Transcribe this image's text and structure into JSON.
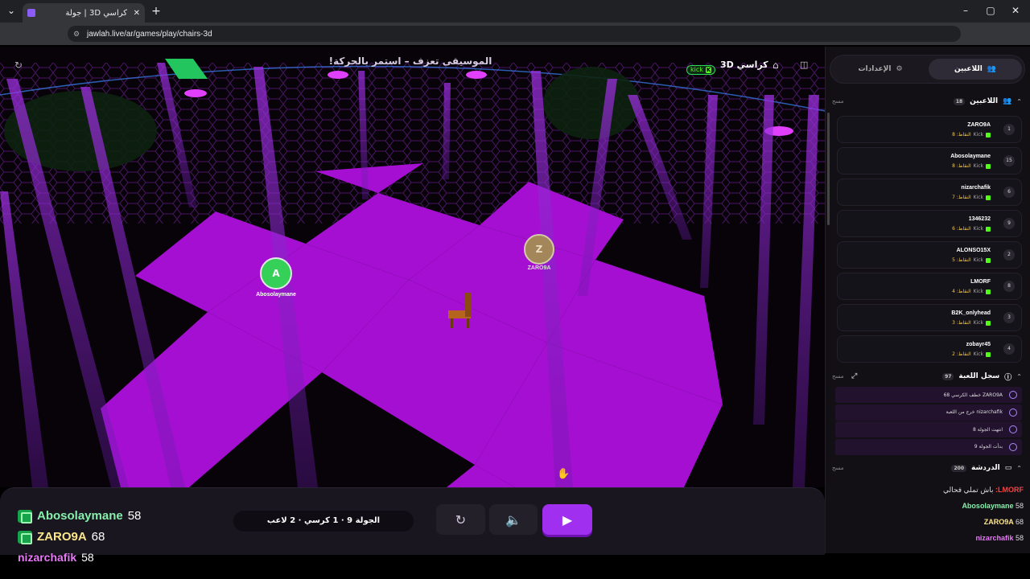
{
  "browser": {
    "tab_title": "كراسي 3D | جولة",
    "url": "jawlah.live/ar/games/play/chairs-3d",
    "new_tab_icon": "plus-icon"
  },
  "game": {
    "music_banner": "الموسيقى تعزف – استمر بالحركة!",
    "title": "كراسي 3D",
    "kick_label": "kick",
    "player_tokens": [
      {
        "initial": "A",
        "name": "Abosolaymane"
      },
      {
        "initial": "Z",
        "name": "ZARO9A"
      }
    ]
  },
  "bottom": {
    "leaderboard": [
      {
        "name": "Abosolaymane",
        "score": "58",
        "color": "#86efac"
      },
      {
        "name": "ZARO9A",
        "score": "68",
        "color": "#fde68a"
      },
      {
        "name": "nizarchafik",
        "score": "58",
        "color": "#e879f9"
      }
    ],
    "round_status": "الجولة 9 · 1 كرسي · 2 لاعب"
  },
  "sidebar": {
    "tabs": {
      "players": "اللاعبين",
      "settings": "الإعدادات"
    },
    "players_section": {
      "title": "اللاعبين",
      "count": "18",
      "clear": "مسح"
    },
    "players": [
      {
        "rank": "1",
        "name": "ZARO9A",
        "points": "النقاط: 8",
        "kick": "Kick"
      },
      {
        "rank": "15",
        "name": "Abosolaymane",
        "points": "النقاط: 8",
        "kick": "Kick"
      },
      {
        "rank": "6",
        "name": "nizarchafik",
        "points": "النقاط: 7",
        "kick": "Kick"
      },
      {
        "rank": "9",
        "name": "1346232",
        "points": "النقاط: 6",
        "kick": "Kick"
      },
      {
        "rank": "2",
        "name": "ALONSO15X",
        "points": "النقاط: 5",
        "kick": "Kick"
      },
      {
        "rank": "8",
        "name": "LMORF",
        "points": "النقاط: 4",
        "kick": "Kick"
      },
      {
        "rank": "3",
        "name": "B2K_onlyhead",
        "points": "النقاط: 3",
        "kick": "Kick"
      },
      {
        "rank": "4",
        "name": "zobayr45",
        "points": "النقاط: 2",
        "kick": "Kick"
      }
    ],
    "log_section": {
      "title": "سجل اللعبة",
      "count": "97",
      "clear": "مسح"
    },
    "log": [
      "ZARO9A خطف الكرسي 68",
      "nizarchafik خرج من اللعبة",
      "انتهت الجولة 8",
      "بدأت الجولة 9"
    ],
    "chat_section": {
      "title": "الدردشة",
      "count": "200",
      "clear": "مسح"
    },
    "chat": [
      {
        "user": "LMORF:",
        "text": "باش تملي فحالي",
        "color": "#ef4444"
      },
      {
        "user": "Abosolaymane",
        "text": "58",
        "color": "#86efac"
      },
      {
        "user": "ZARO9A",
        "text": "68",
        "color": "#fde68a"
      },
      {
        "user": "nizarchafik",
        "text": "58",
        "color": "#e879f9"
      }
    ]
  }
}
